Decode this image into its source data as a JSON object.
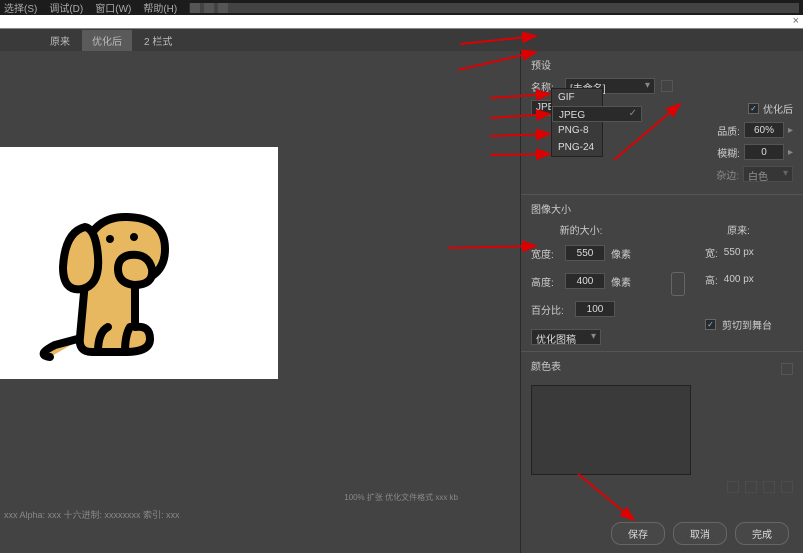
{
  "menu": {
    "items": [
      "选择(S)",
      "调试(D)",
      "窗口(W)",
      "帮助(H)"
    ]
  },
  "dialog_close": "×",
  "tabs": {
    "t1": "原来",
    "t2": "优化后",
    "t3": "2 栏式"
  },
  "preset": {
    "section": "预设",
    "name_lbl": "名称:",
    "name_val": "[未命名]",
    "format": "JPEG",
    "opts": {
      "gif": "GIF",
      "jpeg": "JPEG",
      "png8": "PNG-8",
      "png24": "PNG-24"
    },
    "optimized_lbl": "优化后",
    "quality_lbl": "品质:",
    "quality_val": "60%",
    "blur_lbl": "模糊:",
    "blur_val": "0",
    "matte_lbl": "杂边:",
    "matte_val": "白色"
  },
  "imgsize": {
    "section": "图像大小",
    "new_hdr": "新的大小:",
    "orig_hdr": "原来:",
    "w_lbl": "宽度:",
    "w_val": "550",
    "w_unit": "像素",
    "h_lbl": "高度:",
    "h_val": "400",
    "h_unit": "像素",
    "pct_lbl": "百分比:",
    "pct_val": "100",
    "o_w_lbl": "宽:",
    "o_w_val": "550 px",
    "o_h_lbl": "高:",
    "o_h_val": "400 px",
    "mode": "优化图稿",
    "clip_lbl": "剪切到舞台"
  },
  "palette": {
    "section": "颜色表"
  },
  "footer": {
    "info1": "xxx Alpha: xxx  十六进制: xxxxxxxx  索引: xxx",
    "info2": "100% 扩张\n优化文件格式\n xxx kb"
  },
  "buttons": {
    "save": "保存",
    "cancel": "取消",
    "done": "完成"
  }
}
